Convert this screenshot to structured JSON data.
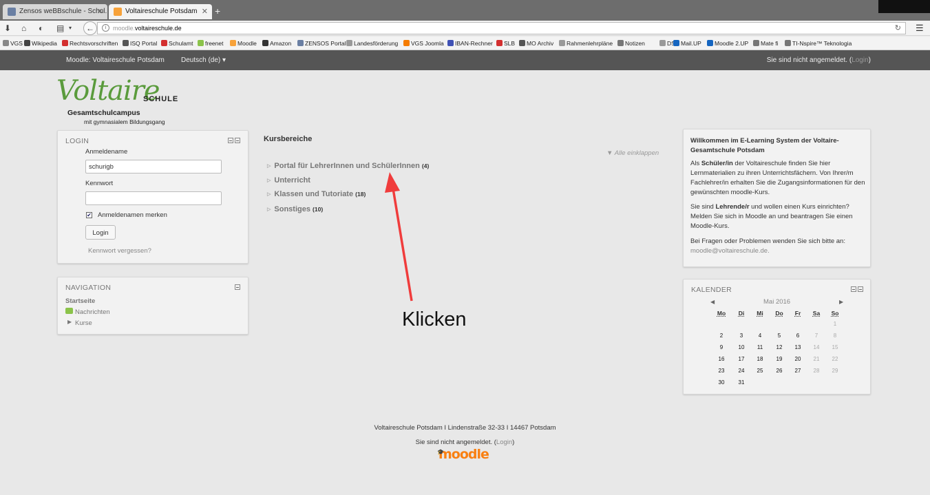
{
  "browser": {
    "tabs": [
      {
        "label": "Zensos weBBschule - Schul..."
      },
      {
        "label": "Voltaireschule Potsdam"
      }
    ],
    "new_tab": "+",
    "url_prefix": "moodle.",
    "url_host": "voltaireschule.de",
    "bookmarks": [
      {
        "label": "VGS",
        "color": "#888888"
      },
      {
        "label": "Wikipedia",
        "color": "#444444"
      },
      {
        "label": "Rechtsvorschriften",
        "color": "#d32f2f"
      },
      {
        "label": "ISQ Portal",
        "color": "#555555"
      },
      {
        "label": "Schulamt",
        "color": "#d32f2f"
      },
      {
        "label": "freenet",
        "color": "#8bc34a"
      },
      {
        "label": "Moodle",
        "color": "#f7a23a"
      },
      {
        "label": "Amazon",
        "color": "#333333"
      },
      {
        "label": "ZENSOS Portal",
        "color": "#6a7fa3"
      },
      {
        "label": "Landesförderung",
        "color": "#999999"
      },
      {
        "label": "VGS Joomla",
        "color": "#f57c00"
      },
      {
        "label": "IBAN-Rechner",
        "color": "#3f51b5"
      },
      {
        "label": "SLB",
        "color": "#d32f2f"
      },
      {
        "label": "MO Archiv",
        "color": "#555555"
      },
      {
        "label": "Rahmenlehrpläne",
        "color": "#999999"
      },
      {
        "label": "Notizen",
        "color": "#777777"
      },
      {
        "label": "DSB",
        "color": "#999999"
      },
      {
        "label": "Mail.UP",
        "color": "#1565c0"
      },
      {
        "label": "Moodle 2.UP",
        "color": "#1565c0"
      },
      {
        "label": "Mate fi",
        "color": "#777777"
      },
      {
        "label": "TI-Nspire™ Teknologia",
        "color": "#777777"
      }
    ]
  },
  "topbar": {
    "site": "Moodle: Voltaireschule Potsdam",
    "lang": "Deutsch (de) ▾",
    "status": "Sie sind nicht angemeldet. (",
    "login_link": "Login",
    "status_end": ")"
  },
  "logo": {
    "name": "Voltaire",
    "schule": "SCHULE",
    "campus": "Gesamtschulcampus",
    "subtitle": "mit gymnasialem Bildungsgang"
  },
  "login": {
    "title": "LOGIN",
    "username_label": "Anmeldename",
    "username_value": "schurigb",
    "password_label": "Kennwort",
    "remember_label": "Anmeldenamen merken",
    "remember_checked": "✔",
    "button": "Login",
    "forgot": "Kennwort vergessen?"
  },
  "navigation": {
    "title": "NAVIGATION",
    "home": "Startseite",
    "news": "Nachrichten",
    "courses": "Kurse"
  },
  "main": {
    "title": "Kursbereiche",
    "collapse_all": "Alle einklappen",
    "categories": [
      {
        "name": "Portal für LehrerInnen und SchülerInnen",
        "count": "(4)"
      },
      {
        "name": "Unterricht",
        "count": ""
      },
      {
        "name": "Klassen und Tutoriate",
        "count": "(18)"
      },
      {
        "name": "Sonstiges",
        "count": "(10)"
      }
    ]
  },
  "welcome": {
    "title": "Willkommen im E-Learning System der Voltaire-Gesamtschule Potsdam",
    "p1_a": "Als ",
    "p1_b": "Schüler/in",
    "p1_c": " der Voltaireschule finden Sie hier Lernmaterialien zu ihren Unterrichtsfächern. Von Ihrer/m Fachlehrer/in erhalten Sie die Zugangsinformationen für den gewünschten moodle-Kurs.",
    "p2_a": "Sie sind ",
    "p2_b": "Lehrende/r",
    "p2_c": " und wollen einen Kurs einrichten? Melden Sie sich in Moodle an und beantragen Sie einen Moodle-Kurs.",
    "p3": "Bei Fragen oder Problemen wenden Sie sich bitte an:",
    "email": "moodle@voltaireschule.de."
  },
  "calendar": {
    "title": "KALENDER",
    "prev": "◀",
    "next": "▶",
    "month": "Mai 2016",
    "weekdays": [
      "Mo",
      "Di",
      "Mi",
      "Do",
      "Fr",
      "Sa",
      "So"
    ],
    "weeks": [
      [
        "",
        "",
        "",
        "",
        "",
        "",
        "1"
      ],
      [
        "2",
        "3",
        "4",
        "5",
        "6",
        "7",
        "8"
      ],
      [
        "9",
        "10",
        "11",
        "12",
        "13",
        "14",
        "15"
      ],
      [
        "16",
        "17",
        "18",
        "19",
        "20",
        "21",
        "22"
      ],
      [
        "23",
        "24",
        "25",
        "26",
        "27",
        "28",
        "29"
      ],
      [
        "30",
        "31",
        "",
        "",
        "",
        "",
        ""
      ]
    ]
  },
  "footer": {
    "address": "Voltaireschule Potsdam I Lindenstraße 32-33 I 14467 Potsdam",
    "status": "Sie sind nicht angemeldet. (",
    "login_link": "Login",
    "status_end": ")",
    "moodle": "moodle"
  },
  "annotation": {
    "text": "Klicken",
    "arrow_color": "#f03c3c"
  }
}
